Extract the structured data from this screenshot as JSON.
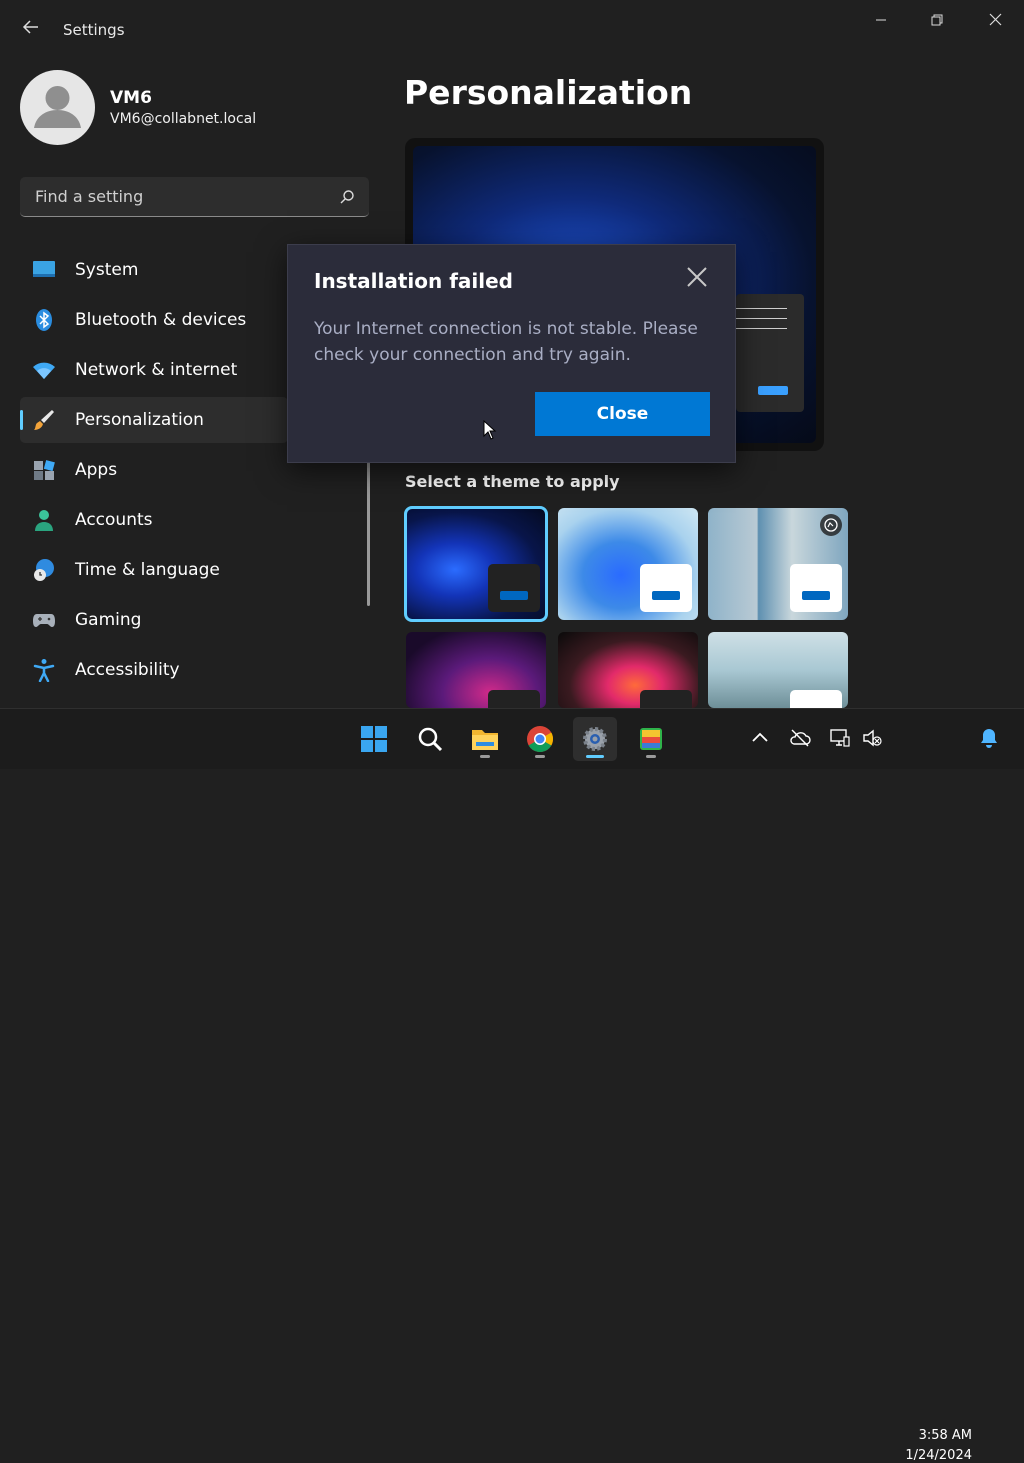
{
  "window": {
    "back_icon": "back-arrow-icon",
    "title": "Settings",
    "controls": [
      "minimize-icon",
      "restore-icon",
      "close-icon"
    ]
  },
  "profile": {
    "name": "VM6",
    "email": "VM6@collabnet.local"
  },
  "search": {
    "placeholder": "Find a setting",
    "icon": "search-icon"
  },
  "sidebar": {
    "items": [
      {
        "label": "System",
        "icon": "system-monitor-icon",
        "active": false
      },
      {
        "label": "Bluetooth & devices",
        "icon": "bluetooth-icon",
        "active": false
      },
      {
        "label": "Network & internet",
        "icon": "wifi-icon",
        "active": false
      },
      {
        "label": "Personalization",
        "icon": "paintbrush-icon",
        "active": true
      },
      {
        "label": "Apps",
        "icon": "apps-icon",
        "active": false
      },
      {
        "label": "Accounts",
        "icon": "person-icon",
        "active": false
      },
      {
        "label": "Time & language",
        "icon": "globe-clock-icon",
        "active": false
      },
      {
        "label": "Gaming",
        "icon": "gamepad-icon",
        "active": false
      },
      {
        "label": "Accessibility",
        "icon": "accessibility-icon",
        "active": false
      }
    ]
  },
  "main": {
    "title": "Personalization",
    "themes_heading": "Select a theme to apply"
  },
  "dialog": {
    "title": "Installation failed",
    "message": "Your Internet connection is not stable. Please check your connection and try again.",
    "close_button": "Close"
  },
  "taskbar": {
    "apps": [
      {
        "name": "start-button",
        "icon": "windows-logo-icon"
      },
      {
        "name": "search-button",
        "icon": "search-icon"
      },
      {
        "name": "file-explorer",
        "icon": "folder-icon"
      },
      {
        "name": "chrome",
        "icon": "chrome-icon"
      },
      {
        "name": "settings",
        "icon": "gear-icon"
      },
      {
        "name": "bluestacks",
        "icon": "bluestacks-icon"
      }
    ],
    "tray_icons": [
      "chevron-up-icon",
      "cloud-offline-icon",
      "network-icon",
      "volume-muted-icon",
      "notification-bell-icon"
    ],
    "time": "3:58 AM",
    "date": "1/24/2024"
  },
  "colors": {
    "accent": "#60cdff",
    "button": "#0078d4",
    "dialog_bg": "#2b2c3a"
  }
}
